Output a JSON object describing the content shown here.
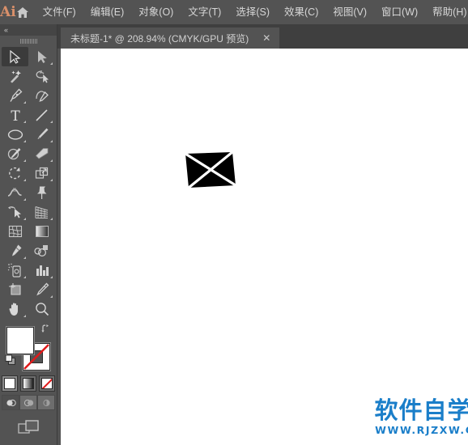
{
  "app": {
    "logo_text": "Ai",
    "logo_color": "#d9906a",
    "home_icon": "home-icon",
    "background_color": "#535353",
    "canvas_color": "#ffffff"
  },
  "menubar": {
    "items": [
      {
        "label": "文件(F)"
      },
      {
        "label": "编辑(E)"
      },
      {
        "label": "对象(O)"
      },
      {
        "label": "文字(T)"
      },
      {
        "label": "选择(S)"
      },
      {
        "label": "效果(C)"
      },
      {
        "label": "视图(V)"
      },
      {
        "label": "窗口(W)"
      },
      {
        "label": "帮助(H)"
      }
    ]
  },
  "tabbar": {
    "tabs": [
      {
        "title": "未标题-1* @ 208.94% (CMYK/GPU 预览)",
        "close_label": "✕",
        "active": true
      }
    ]
  },
  "toolpanel": {
    "collapse_label": "«",
    "grip_icon": "drag-grip-icon",
    "tools": [
      {
        "name": "selection-tool",
        "icon": "arrow-cursor-icon",
        "active": true,
        "has_flyout": false
      },
      {
        "name": "direct-selection-tool",
        "icon": "white-arrow-cursor-icon",
        "active": false,
        "has_flyout": true
      },
      {
        "name": "magic-wand-tool",
        "icon": "magic-wand-icon",
        "active": false,
        "has_flyout": false
      },
      {
        "name": "lasso-tool",
        "icon": "lasso-icon",
        "active": false,
        "has_flyout": false
      },
      {
        "name": "pen-tool",
        "icon": "pen-nib-icon",
        "active": false,
        "has_flyout": true
      },
      {
        "name": "curvature-tool",
        "icon": "curvature-pen-icon",
        "active": false,
        "has_flyout": false
      },
      {
        "name": "type-tool",
        "icon": "type-t-icon",
        "active": false,
        "has_flyout": true
      },
      {
        "name": "line-segment-tool",
        "icon": "line-diagonal-icon",
        "active": false,
        "has_flyout": true
      },
      {
        "name": "ellipse-tool",
        "icon": "ellipse-icon",
        "active": false,
        "has_flyout": true
      },
      {
        "name": "paintbrush-tool",
        "icon": "paintbrush-icon",
        "active": false,
        "has_flyout": true
      },
      {
        "name": "shaper-pencil-tool",
        "icon": "pencil-shaper-icon",
        "active": false,
        "has_flyout": true
      },
      {
        "name": "eraser-tool",
        "icon": "eraser-icon",
        "active": false,
        "has_flyout": true
      },
      {
        "name": "rotate-tool",
        "icon": "rotate-icon",
        "active": false,
        "has_flyout": true
      },
      {
        "name": "scale-tool",
        "icon": "scale-icon",
        "active": false,
        "has_flyout": true
      },
      {
        "name": "width-tool",
        "icon": "width-warp-icon",
        "active": false,
        "has_flyout": true
      },
      {
        "name": "puppet-warp-tool",
        "icon": "pushpin-icon",
        "active": false,
        "has_flyout": false
      },
      {
        "name": "free-transform-tool",
        "icon": "free-transform-icon",
        "active": false,
        "has_flyout": true
      },
      {
        "name": "perspective-grid-tool",
        "icon": "perspective-grid-icon",
        "active": false,
        "has_flyout": true
      },
      {
        "name": "mesh-tool",
        "icon": "mesh-icon",
        "active": false,
        "has_flyout": false
      },
      {
        "name": "gradient-tool",
        "icon": "gradient-icon",
        "active": false,
        "has_flyout": false
      },
      {
        "name": "eyedropper-tool",
        "icon": "eyedropper-icon",
        "active": false,
        "has_flyout": true
      },
      {
        "name": "blend-tool",
        "icon": "blend-icon",
        "active": false,
        "has_flyout": false
      },
      {
        "name": "symbol-sprayer-tool",
        "icon": "symbol-sprayer-icon",
        "active": false,
        "has_flyout": true
      },
      {
        "name": "column-graph-tool",
        "icon": "bar-chart-icon",
        "active": false,
        "has_flyout": true
      },
      {
        "name": "artboard-tool",
        "icon": "artboard-icon",
        "active": false,
        "has_flyout": false
      },
      {
        "name": "slice-tool",
        "icon": "slice-knife-icon",
        "active": false,
        "has_flyout": true
      },
      {
        "name": "hand-tool",
        "icon": "hand-icon",
        "active": false,
        "has_flyout": true
      },
      {
        "name": "zoom-tool",
        "icon": "magnifier-icon",
        "active": false,
        "has_flyout": false
      }
    ],
    "fill_stroke": {
      "fill_name": "fill-swatch",
      "fill_color": "#ffffff",
      "stroke_name": "stroke-swatch",
      "stroke_color": "none",
      "none_slash_color": "#e01b1b",
      "swap_icon": "swap-fill-stroke-icon",
      "default_icon": "default-fill-stroke-icon"
    },
    "paint_modes": [
      {
        "name": "color-mode-button",
        "icon": "solid-color-icon",
        "selected": true
      },
      {
        "name": "gradient-mode-button",
        "icon": "gradient-swatch-icon",
        "selected": false
      },
      {
        "name": "none-mode-button",
        "icon": "none-swatch-icon",
        "selected": false
      }
    ],
    "draw_modes": [
      {
        "name": "draw-normal-button",
        "icon": "draw-normal-icon",
        "selected": true
      },
      {
        "name": "draw-behind-button",
        "icon": "draw-behind-icon",
        "selected": false
      },
      {
        "name": "draw-inside-button",
        "icon": "draw-inside-icon",
        "selected": false
      }
    ],
    "screen_mode": {
      "name": "change-screen-mode-button",
      "icon": "screen-mode-icon"
    }
  },
  "canvas": {
    "artwork": {
      "name": "envelope-shape",
      "description": "black skewed quadrilateral with white crossing diagonals",
      "fill": "#000000",
      "line_color": "#ffffff"
    }
  },
  "watermark": {
    "chinese": "软件自学网",
    "url": "WWW.RJZXW.COM",
    "color": "#1a7ec9"
  }
}
